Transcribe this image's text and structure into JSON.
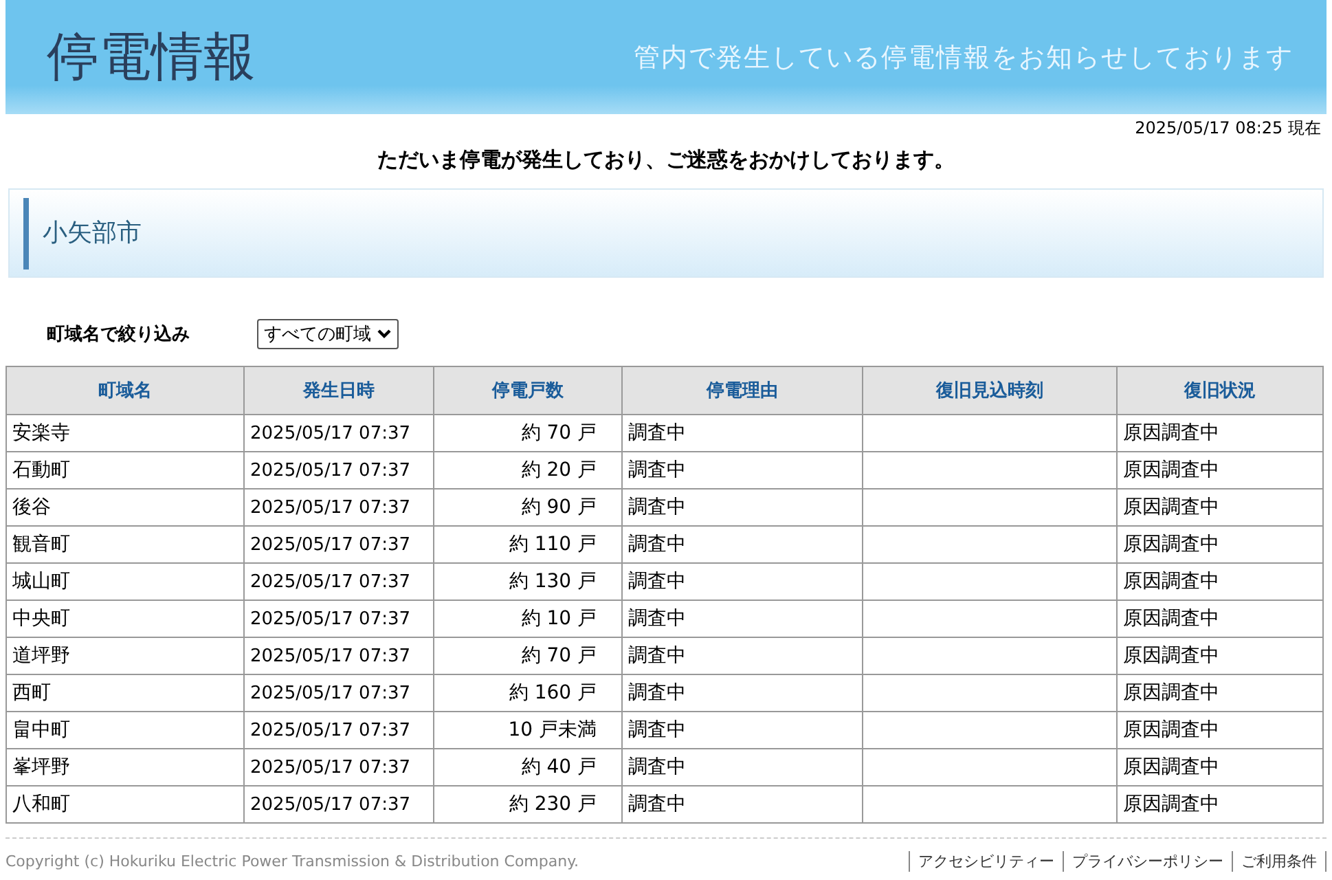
{
  "header": {
    "title": "停電情報",
    "subtitle": "管内で発生している停電情報をお知らせしております"
  },
  "timestamp": "2025/05/17 08:25 現在",
  "notice": "ただいま停電が発生しており、ご迷惑をおかけしております。",
  "city": "小矢部市",
  "filter": {
    "label": "町域名で絞り込み",
    "value": "すべての町域"
  },
  "table": {
    "columns": [
      "町域名",
      "発生日時",
      "停電戸数",
      "停電理由",
      "復旧見込時刻",
      "復旧状況"
    ],
    "rows": [
      [
        "安楽寺",
        "2025/05/17 07:37",
        "約 70 戸",
        "調査中",
        "",
        "原因調査中"
      ],
      [
        "石動町",
        "2025/05/17 07:37",
        "約 20 戸",
        "調査中",
        "",
        "原因調査中"
      ],
      [
        "後谷",
        "2025/05/17 07:37",
        "約 90 戸",
        "調査中",
        "",
        "原因調査中"
      ],
      [
        "観音町",
        "2025/05/17 07:37",
        "約 110 戸",
        "調査中",
        "",
        "原因調査中"
      ],
      [
        "城山町",
        "2025/05/17 07:37",
        "約 130 戸",
        "調査中",
        "",
        "原因調査中"
      ],
      [
        "中央町",
        "2025/05/17 07:37",
        "約 10 戸",
        "調査中",
        "",
        "原因調査中"
      ],
      [
        "道坪野",
        "2025/05/17 07:37",
        "約 70 戸",
        "調査中",
        "",
        "原因調査中"
      ],
      [
        "西町",
        "2025/05/17 07:37",
        "約 160 戸",
        "調査中",
        "",
        "原因調査中"
      ],
      [
        "畠中町",
        "2025/05/17 07:37",
        "10 戸未満",
        "調査中",
        "",
        "原因調査中"
      ],
      [
        "峯坪野",
        "2025/05/17 07:37",
        "約 40 戸",
        "調査中",
        "",
        "原因調査中"
      ],
      [
        "八和町",
        "2025/05/17 07:37",
        "約 230 戸",
        "調査中",
        "",
        "原因調査中"
      ]
    ]
  },
  "footer": {
    "copyright": "Copyright (c) Hokuriku Electric Power Transmission & Distribution Company.",
    "links": [
      "アクセシビリティー",
      "プライバシーポリシー",
      "ご利用条件"
    ]
  }
}
